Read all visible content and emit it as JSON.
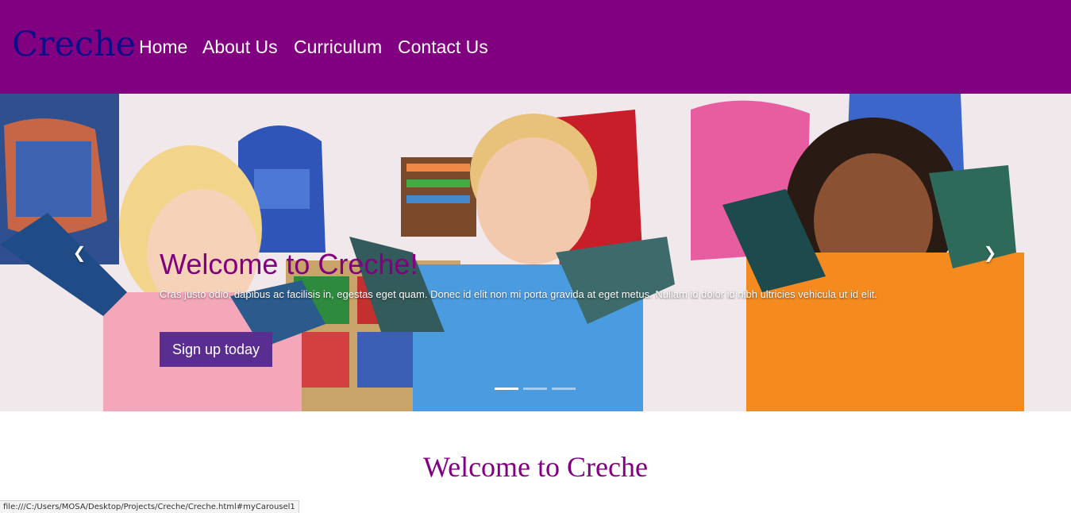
{
  "navbar": {
    "brand": "Creche",
    "links": [
      "Home",
      "About Us",
      "Curriculum",
      "Contact Us"
    ],
    "background_color": "#800080",
    "brand_color": "#0d0d8a"
  },
  "carousel": {
    "title": "Welcome to Creche!",
    "text": "Cras justo odio, dapibus ac facilisis in, egestas eget quam. Donec id elit non mi porta gravida at eget metus. Nullam id dolor id nibh ultricies vehicula ut id elit.",
    "button_label": "Sign up today",
    "prev_icon": "chevron-left-icon",
    "next_icon": "chevron-right-icon",
    "slide_count": 3,
    "active_slide": 1,
    "title_color": "#800080",
    "button_color": "#5a2d91"
  },
  "main": {
    "heading": "Welcome to Creche"
  },
  "status_bar": {
    "url": "file:///C:/Users/MOSA/Desktop/Projects/Creche/Creche.html#myCarousel1"
  }
}
